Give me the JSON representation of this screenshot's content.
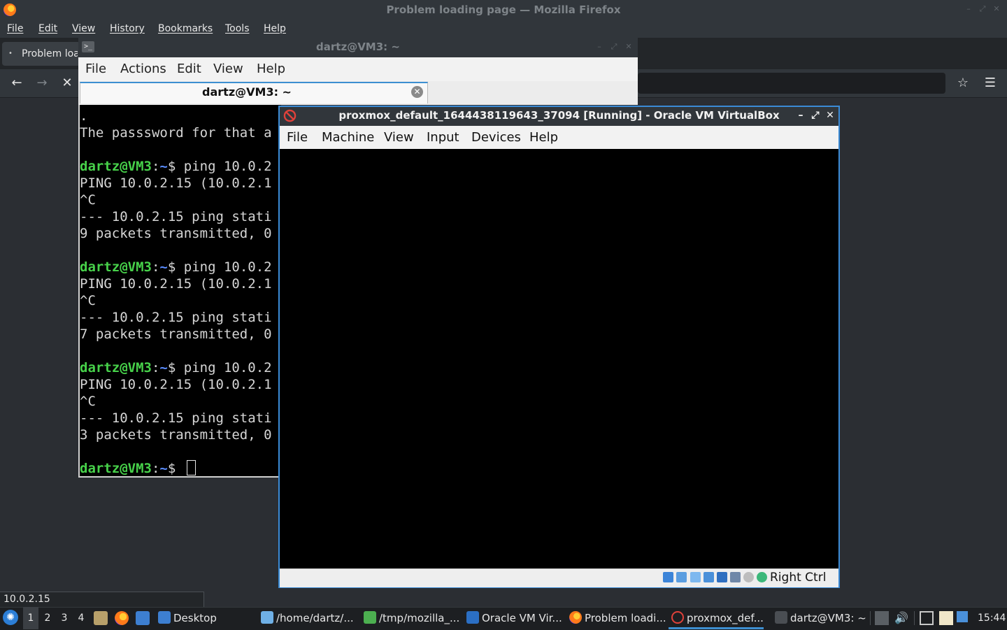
{
  "firefox": {
    "title": "Problem loading page — Mozilla Firefox",
    "menu": [
      "File",
      "Edit",
      "View",
      "History",
      "Bookmarks",
      "Tools",
      "Help"
    ],
    "tab_label": "Problem loa",
    "status_text": "10.0.2.15"
  },
  "terminal": {
    "title": "dartz@VM3: ~",
    "menu": [
      "File",
      "Actions",
      "Edit",
      "View",
      "Help"
    ],
    "tab_label": "dartz@VM3: ~",
    "prompt_user": "dartz@VM3",
    "prompt_sep": ":",
    "prompt_path": "~",
    "prompt_dollar": "$ ",
    "lines": [
      ".",
      "The passsword for that a",
      "",
      "ping 10.0.2",
      "PING 10.0.2.15 (10.0.2.1",
      "^C",
      "--- 10.0.2.15 ping stati",
      "9 packets transmitted, 0",
      "",
      "ping 10.0.2",
      "PING 10.0.2.15 (10.0.2.1",
      "^C",
      "--- 10.0.2.15 ping stati",
      "7 packets transmitted, 0",
      "",
      "ping 10.0.2",
      "PING 10.0.2.15 (10.0.2.1",
      "^C",
      "--- 10.0.2.15 ping stati",
      "3 packets transmitted, 0",
      ""
    ]
  },
  "virtualbox": {
    "title": "proxmox_default_1644438119643_37094 [Running] - Oracle VM VirtualBox",
    "menu": [
      "File",
      "Machine",
      "View",
      "Input",
      "Devices",
      "Help"
    ],
    "host_key": "Right Ctrl"
  },
  "taskbar": {
    "workspaces": [
      "1",
      "2",
      "3",
      "4"
    ],
    "items": {
      "desktop": "Desktop",
      "home": "/home/dartz/...",
      "tmp": "/tmp/mozilla_...",
      "oracle": "Oracle VM Vir...",
      "firefox": "Problem loadi...",
      "proxmox": "proxmox_def...",
      "terminal": "dartz@VM3: ~"
    },
    "clock": "15:44"
  },
  "colors": {
    "accent": "#3d8fd1",
    "prompt_green": "#47d14a",
    "prompt_blue": "#5a8cff"
  }
}
